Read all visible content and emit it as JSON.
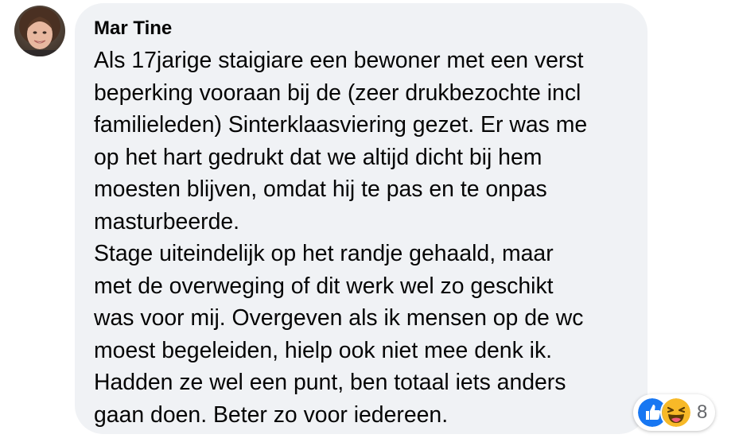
{
  "comment": {
    "author": "Mar Tine",
    "lines": [
      "Als 17jarige staigiare een bewoner met een verst",
      "beperking vooraan bij de (zeer drukbezochte incl",
      "familieleden) Sinterklaasviering gezet. Er was me",
      "op het hart gedrukt dat we altijd dicht bij hem",
      "moesten blijven, omdat hij te pas en te onpas",
      "masturbeerde.",
      "Stage uiteindelijk op het randje gehaald, maar",
      "met de overweging of dit werk wel zo geschikt",
      "was voor mij. Overgeven als ik mensen op de wc",
      "moest begeleiden, hielp ook niet mee denk ik.",
      "Hadden ze wel een punt, ben totaal iets anders",
      "gaan doen. Beter zo voor iedereen."
    ],
    "reactions": {
      "icons": [
        "like-icon",
        "haha-icon"
      ],
      "count": "8"
    }
  },
  "colors": {
    "bubble": "#f0f2f5",
    "text": "#050505",
    "secondary_text": "#65676b",
    "like_blue": "#1877f2",
    "haha_yellow": "#f7b928"
  }
}
